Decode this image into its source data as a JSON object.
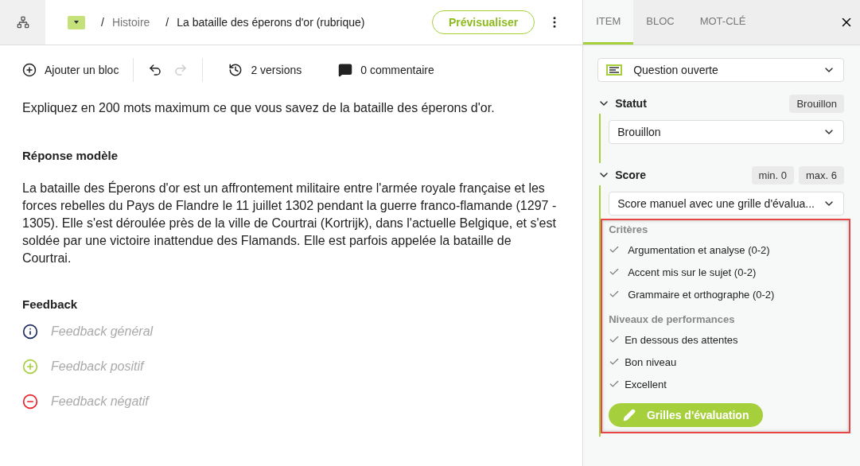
{
  "breadcrumb": [
    {
      "separator": "/",
      "label": "Histoire"
    },
    {
      "separator": "/",
      "label": "La bataille des éperons d'or (rubrique)"
    }
  ],
  "preview_button": "Prévisualiser",
  "toolbar": {
    "add_block": "Ajouter un bloc",
    "undo": {
      "disabled": false
    },
    "redo": {
      "disabled": true
    },
    "versions": "2 versions",
    "comments": "0 commentaire"
  },
  "question": "Expliquez en 200 mots maximum ce que vous savez de la bataille des éperons d'or.",
  "model_answer": {
    "title": "Réponse modèle",
    "text": "La bataille des Éperons d'or est un affrontement militaire entre l'armée royale française et les forces rebelles du Pays de Flandre le 11 juillet 1302 pendant la guerre franco-flamande (1297 - 1305). Elle s'est déroulée près de la ville de Courtrai (Kortrijk), dans l'actuelle Belgique, et s'est soldée par une victoire inattendue des Flamands. Elle est parfois appelée la bataille de Courtrai."
  },
  "feedback": {
    "title": "Feedback",
    "items": [
      {
        "kind": "general",
        "placeholder": "Feedback général"
      },
      {
        "kind": "positive",
        "placeholder": "Feedback positif"
      },
      {
        "kind": "negative",
        "placeholder": "Feedback négatif"
      }
    ]
  },
  "sidebar": {
    "tabs": [
      {
        "label": "ITEM",
        "selected": true
      },
      {
        "label": "BLOC",
        "selected": false
      },
      {
        "label": "MOT-CLÉ",
        "selected": false
      }
    ],
    "item_type": "Question ouverte",
    "status": {
      "title": "Statut",
      "expanded": true,
      "badge": "Brouillon",
      "value": "Brouillon"
    },
    "score": {
      "title": "Score",
      "expanded": true,
      "min": "min. 0",
      "max": "max. 6",
      "value": "Score manuel avec une grille d'évalua...",
      "criteria_title": "Critères",
      "criteria": [
        {
          "label": "Argumentation et analyse (0-2)",
          "checked": true
        },
        {
          "label": "Accent mis sur le sujet (0-2)",
          "checked": true
        },
        {
          "label": "Grammaire et orthographe (0-2)",
          "checked": true
        }
      ],
      "levels_title": "Niveaux de performances",
      "levels": [
        {
          "label": "En dessous des attentes",
          "checked": true
        },
        {
          "label": "Bon niveau",
          "checked": true
        },
        {
          "label": "Excellent",
          "checked": true
        }
      ],
      "rubric_button": "Grilles d'évaluation"
    }
  }
}
